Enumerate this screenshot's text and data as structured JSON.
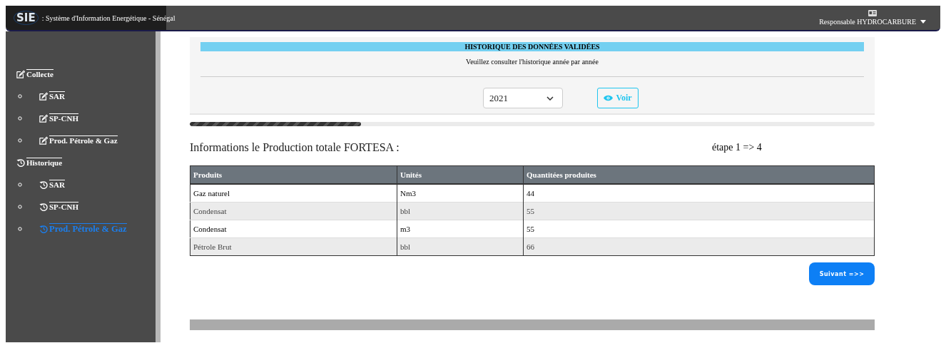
{
  "header": {
    "logo": "SIE",
    "title": ": Système d'Information Energétique - Sénégal",
    "user": "Responsable HYDROCARBURE"
  },
  "sidebar": {
    "sections": [
      {
        "label": "Collecte",
        "kind": "edit",
        "items": [
          {
            "label": "SAR",
            "selected": false
          },
          {
            "label": "SP-CNH",
            "selected": false
          },
          {
            "label": "Prod. Pétrole & Gaz",
            "selected": false
          }
        ]
      },
      {
        "label": "Historique",
        "kind": "history",
        "items": [
          {
            "label": "SAR",
            "selected": false
          },
          {
            "label": "SP-CNH",
            "selected": false
          },
          {
            "label": "Prod. Pétrole & Gaz",
            "selected": true
          }
        ]
      }
    ]
  },
  "history_panel": {
    "title": "HISTORIQUE DES DONNÉES VALIDÉES",
    "subtitle": "Veuillez consulter l'historique année par année",
    "year": "2021",
    "view_button": "Voir"
  },
  "progress": {
    "level": 0.25
  },
  "section": {
    "title": "Informations le Production totale FORTESA :",
    "step": "étape 1 => 4"
  },
  "table": {
    "columns": [
      "Produits",
      "Unités",
      "Quantitées produites"
    ],
    "rows": [
      [
        "Gaz naturel",
        "Nm3",
        "44"
      ],
      [
        "Condensat",
        "bbl",
        "55"
      ],
      [
        "Condensat",
        "m3",
        "55"
      ],
      [
        "Pétrole Brut",
        "bbl",
        "66"
      ]
    ]
  },
  "next_button": "Suivant =>>"
}
